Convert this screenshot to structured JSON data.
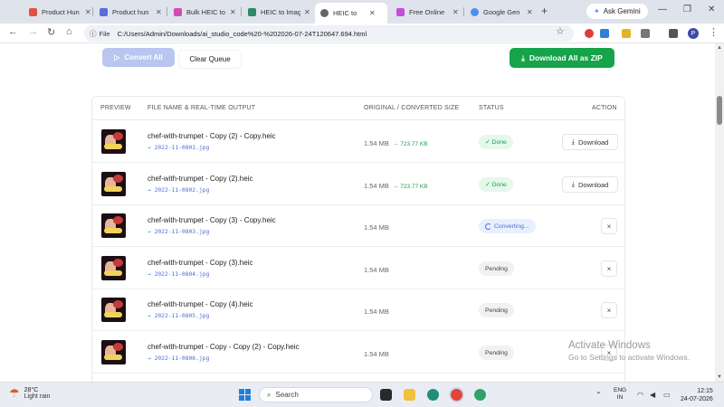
{
  "browser": {
    "tabs": [
      {
        "label": "Product Hun",
        "color": "#e0533f"
      },
      {
        "label": "Product hun",
        "color": "#5b6bd8"
      },
      {
        "label": "Bulk HEIC to",
        "color": "#d14bb5"
      },
      {
        "label": "HEIC to Imag",
        "color": "#2b8a6b"
      },
      {
        "label": "HEIC to",
        "color": "#666666"
      },
      {
        "label": "Free Online",
        "color": "#c84bd8"
      },
      {
        "label": "Google Gen",
        "color": "#4f8cf0"
      }
    ],
    "gemini_label": "Ask Gemini",
    "address_chip": "File",
    "url": "C:/Users/Admin/Downloads/ai_studio_code%20-%202026-07-24T120647.694.html",
    "profile_initial": "P"
  },
  "toolbar": {
    "convert_all": "Convert All",
    "clear_queue": "Clear Queue",
    "download_zip": "Download All as ZIP"
  },
  "table": {
    "headers": {
      "preview": "PREVIEW",
      "file": "FILE NAME & REAL-TIME OUTPUT",
      "size": "ORIGINAL / CONVERTED SIZE",
      "status": "STATUS",
      "action": "ACTION"
    },
    "rows": [
      {
        "name": "chef-with-trumpet - Copy (2) - Copy.heic",
        "output": "→ 2022-11-0801.jpg",
        "original": "1.54 MB",
        "converted": "→ 723.77 KB",
        "status": "✓ Done",
        "action": "Download"
      },
      {
        "name": "chef-with-trumpet - Copy (2).heic",
        "output": "→ 2022-11-0802.jpg",
        "original": "1.54 MB",
        "converted": "→ 723.77 KB",
        "status": "✓ Done",
        "action": "Download"
      },
      {
        "name": "chef-with-trumpet - Copy (3) - Copy.heic",
        "output": "→ 2022-11-0803.jpg",
        "original": "1.54 MB",
        "converted": "",
        "status": "Converting...",
        "action": "×"
      },
      {
        "name": "chef-with-trumpet - Copy (3).heic",
        "output": "→ 2022-11-0804.jpg",
        "original": "1.54 MB",
        "converted": "",
        "status": "Pending",
        "action": "×"
      },
      {
        "name": "chef-with-trumpet - Copy (4).heic",
        "output": "→ 2022-11-0805.jpg",
        "original": "1.54 MB",
        "converted": "",
        "status": "Pending",
        "action": "×"
      },
      {
        "name": "chef-with-trumpet - Copy - Copy (2) - Copy.heic",
        "output": "→ 2022-11-0806.jpg",
        "original": "1.54 MB",
        "converted": "",
        "status": "Pending",
        "action": "×"
      }
    ]
  },
  "watermark": {
    "line1": "Activate Windows",
    "line2": "Go to Settings to activate Windows."
  },
  "taskbar": {
    "temperature": "28°C",
    "weather": "Light rain",
    "search_placeholder": "Search",
    "lang_line1": "ENG",
    "lang_line2": "IN",
    "time": "12:15",
    "date": "24-07-2026"
  },
  "colors": {
    "accent_green": "#16a34a",
    "accent_blue": "#4b6fd6",
    "convert_disabled": "#b9c6ef"
  }
}
